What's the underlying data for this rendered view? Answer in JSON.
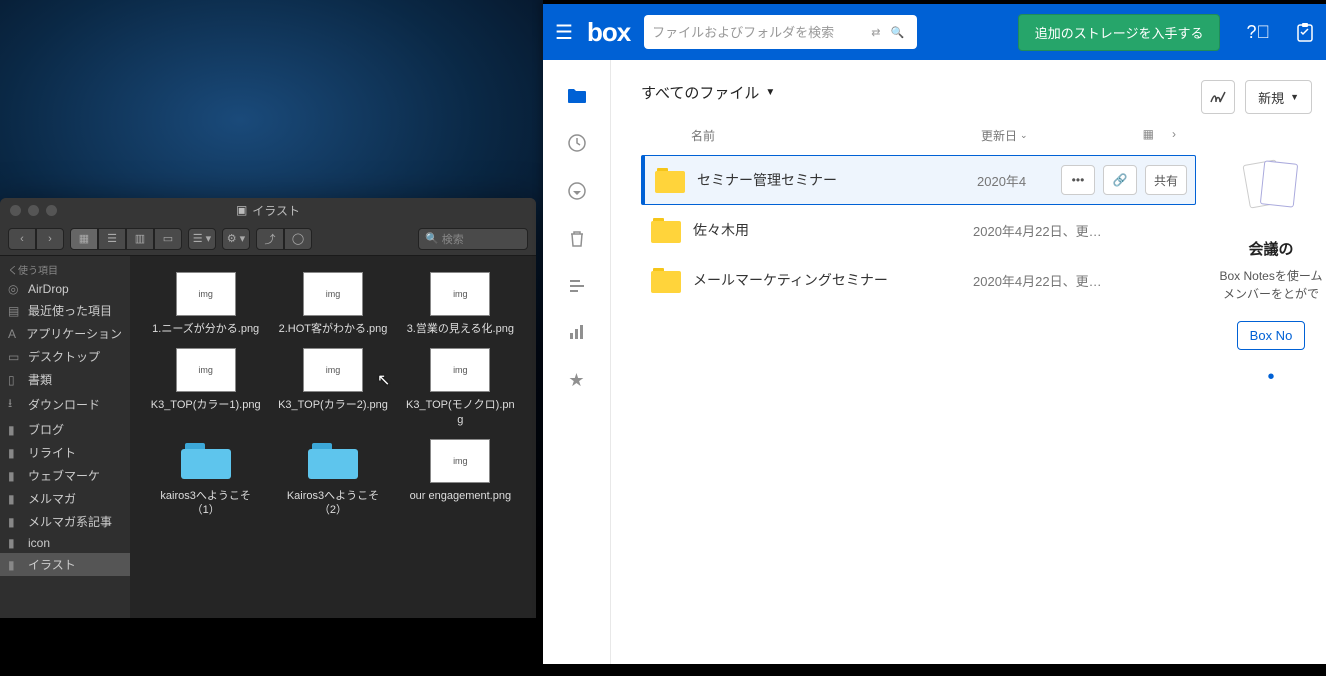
{
  "finder": {
    "title": "イラスト",
    "search_placeholder": "検索",
    "sidebar": {
      "section": "く使う項目",
      "items": [
        {
          "label": "AirDrop",
          "icon": "◎"
        },
        {
          "label": "最近使った項目",
          "icon": "▤"
        },
        {
          "label": "アプリケーション",
          "icon": "A"
        },
        {
          "label": "デスクトップ",
          "icon": "▭"
        },
        {
          "label": "書類",
          "icon": "▯"
        },
        {
          "label": "ダウンロード",
          "icon": "⭳"
        },
        {
          "label": "ブログ",
          "icon": "▮"
        },
        {
          "label": "リライト",
          "icon": "▮"
        },
        {
          "label": "ウェブマーケ",
          "icon": "▮"
        },
        {
          "label": "メルマガ",
          "icon": "▮"
        },
        {
          "label": "メルマガ系記事",
          "icon": "▮"
        },
        {
          "label": "icon",
          "icon": "▮"
        },
        {
          "label": "イラスト",
          "icon": "▮",
          "selected": true
        }
      ]
    },
    "files": [
      {
        "label": "1.ニーズが分かる.png",
        "type": "png"
      },
      {
        "label": "2.HOT客がわかる.png",
        "type": "png"
      },
      {
        "label": "3.営業の見える化.png",
        "type": "png"
      },
      {
        "label": "K3_TOP(カラー1).png",
        "type": "png"
      },
      {
        "label": "K3_TOP(カラー2).png",
        "type": "png"
      },
      {
        "label": "K3_TOP(モノクロ).png",
        "type": "png"
      },
      {
        "label": "kairos3へようこそ（1）",
        "type": "folder"
      },
      {
        "label": "Kairos3へようこそ（2）",
        "type": "folder"
      },
      {
        "label": "our engagement.png",
        "type": "png"
      }
    ]
  },
  "box": {
    "search_placeholder": "ファイルおよびフォルダを検索",
    "storage_btn": "追加のストレージを入手する",
    "breadcrumb": "すべてのファイル",
    "new_btn": "新規",
    "col_name": "名前",
    "col_date": "更新日",
    "rows": [
      {
        "name": "セミナー管理セミナー",
        "date": "2020年4",
        "active": true,
        "share": "共有"
      },
      {
        "name": "佐々木用",
        "date": "2020年4月22日、更…"
      },
      {
        "name": "メールマーケティングセミナー",
        "date": "2020年4月22日、更…"
      }
    ],
    "right": {
      "title": "会議の",
      "text": "Box Notesを使ームメンバーをとがで",
      "btn": "Box No"
    }
  }
}
